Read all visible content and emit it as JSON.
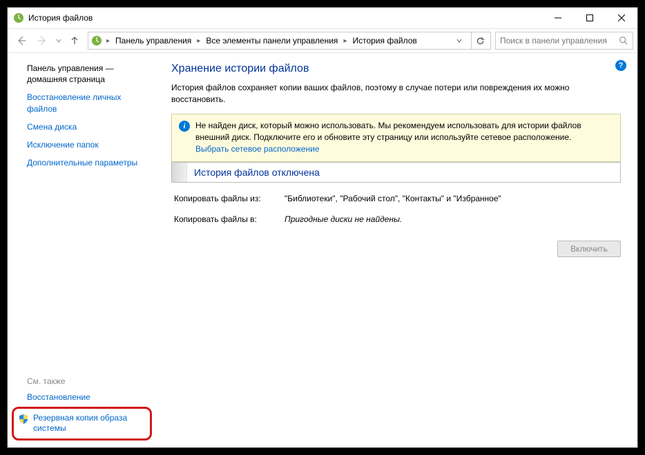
{
  "titlebar": {
    "title": "История файлов"
  },
  "toolbar": {
    "breadcrumbs": [
      "Панель управления",
      "Все элементы панели управления",
      "История файлов"
    ],
    "search_placeholder": "Поиск в панели управления"
  },
  "sidebar": {
    "home": "Панель управления — домашняя страница",
    "links": [
      "Восстановление личных файлов",
      "Смена диска",
      "Исключение папок",
      "Дополнительные параметры"
    ],
    "see_also_header": "См. также",
    "see_also": [
      "Восстановление",
      "Резервная копия образа системы"
    ]
  },
  "main": {
    "title": "Хранение истории файлов",
    "description": "История файлов сохраняет копии ваших файлов, поэтому в случае потери или повреждения их можно восстановить.",
    "info_msg": "Не найден диск, который можно использовать. Мы рекомендуем использовать для истории файлов внешний диск. Подключите его и обновите эту страницу или используйте сетевое расположение.",
    "info_link": "Выбрать сетевое расположение",
    "status": "История файлов отключена",
    "copy_from_label": "Копировать файлы из:",
    "copy_from_value": "\"Библиотеки\", \"Рабочий стол\", \"Контакты\" и \"Избранное\"",
    "copy_to_label": "Копировать файлы в:",
    "copy_to_value": "Пригодные диски не найдены.",
    "enable_button": "Включить"
  }
}
